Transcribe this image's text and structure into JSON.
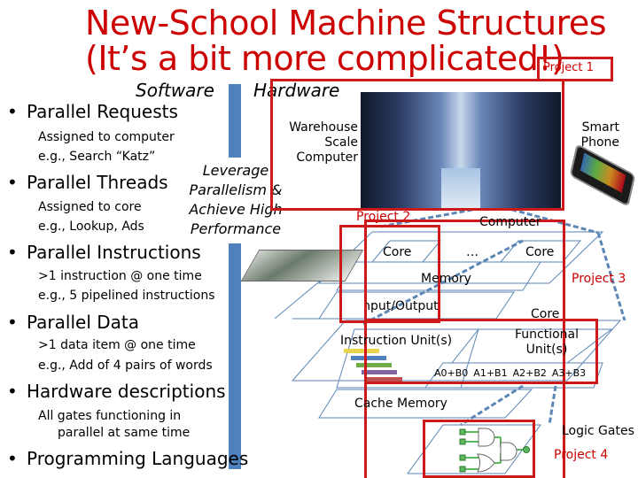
{
  "slide": {
    "title_line1": "New-School Machine Structures",
    "title_line2": "(It’s a bit more complicated!)",
    "header_software": "Software",
    "header_hardware": "Hardware",
    "leverage": [
      "Leverage",
      "Parallelism &",
      "Achieve High",
      "Performance"
    ]
  },
  "bullets": [
    {
      "label": "Parallel Requests",
      "subs": [
        "Assigned to computer",
        "e.g., Search “Katz”"
      ]
    },
    {
      "label": "Parallel Threads",
      "subs": [
        "Assigned to core",
        "e.g., Lookup, Ads"
      ]
    },
    {
      "label": "Parallel Instructions",
      "subs": [
        ">1 instruction @ one time",
        "e.g., 5 pipelined instructions"
      ]
    },
    {
      "label": "Parallel Data",
      "subs": [
        ">1 data item @ one time",
        "e.g., Add of 4 pairs of words"
      ]
    },
    {
      "label": "Hardware descriptions",
      "subs": [
        "All gates functioning in",
        "parallel at same time"
      ]
    },
    {
      "label": "Programming Languages",
      "subs": []
    }
  ],
  "hardware": {
    "warehouse": [
      "Warehouse",
      "Scale",
      "Computer"
    ],
    "smartphone": [
      "Smart",
      "Phone"
    ],
    "computer": "Computer",
    "core_left": "Core",
    "ellipsis": "…",
    "core_right": "Core",
    "memory": "Memory",
    "io": "Input/Output",
    "core_big": "Core",
    "instruction_unit": "Instruction Unit(s)",
    "functional_units": [
      "Functional",
      "Unit(s)"
    ],
    "adders": [
      "A0+B0",
      "A1+B1",
      "A2+B2",
      "A3+B3"
    ],
    "cache": "Cache Memory",
    "logic_gates": "Logic Gates"
  },
  "projects": {
    "p1": "Project 1",
    "p2": "Project 2",
    "p3": "Project 3",
    "p4": "Project 4"
  },
  "colors": {
    "title_red": "#cc0000",
    "box_red": "#cc1a1a",
    "bar_blue": "#4f81bd",
    "line_blue": "#5b86b5"
  }
}
